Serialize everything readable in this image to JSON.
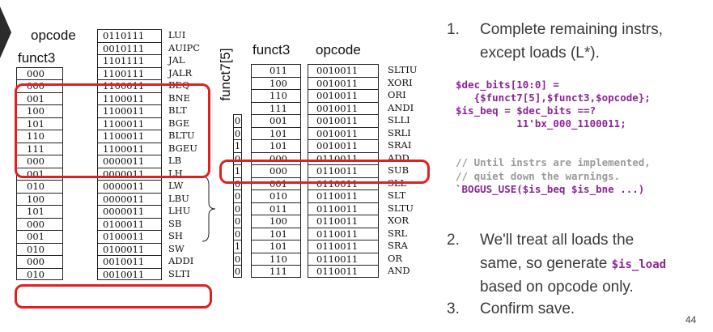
{
  "left_table": {
    "opcode_header": "opcode",
    "funct3_header": "funct3",
    "rows": [
      {
        "f3": "",
        "op": "0110111",
        "name": "LUI"
      },
      {
        "f3": "",
        "op": "0010111",
        "name": "AUIPC"
      },
      {
        "f3": "",
        "op": "1101111",
        "name": "JAL"
      },
      {
        "f3": "000",
        "op": "1100111",
        "name": "JALR"
      },
      {
        "f3": "000",
        "op": "1100011",
        "name": "BEQ"
      },
      {
        "f3": "001",
        "op": "1100011",
        "name": "BNE"
      },
      {
        "f3": "100",
        "op": "1100011",
        "name": "BLT"
      },
      {
        "f3": "101",
        "op": "1100011",
        "name": "BGE"
      },
      {
        "f3": "110",
        "op": "1100011",
        "name": "BLTU"
      },
      {
        "f3": "111",
        "op": "1100011",
        "name": "BGEU"
      },
      {
        "f3": "000",
        "op": "0000011",
        "name": "LB"
      },
      {
        "f3": "001",
        "op": "0000011",
        "name": "LH"
      },
      {
        "f3": "010",
        "op": "0000011",
        "name": "LW"
      },
      {
        "f3": "100",
        "op": "0000011",
        "name": "LBU"
      },
      {
        "f3": "101",
        "op": "0000011",
        "name": "LHU"
      },
      {
        "f3": "000",
        "op": "0100011",
        "name": "SB"
      },
      {
        "f3": "001",
        "op": "0100011",
        "name": "SH"
      },
      {
        "f3": "010",
        "op": "0100011",
        "name": "SW"
      },
      {
        "f3": "000",
        "op": "0010011",
        "name": "ADDI"
      },
      {
        "f3": "010",
        "op": "0010011",
        "name": "SLTI"
      }
    ]
  },
  "right_table": {
    "funct7_header": "funct7[5]",
    "funct3_header": "funct3",
    "opcode_header": "opcode",
    "rows": [
      {
        "f7": "",
        "f3": "011",
        "op": "0010011",
        "name": "SLTIU"
      },
      {
        "f7": "",
        "f3": "100",
        "op": "0010011",
        "name": "XORI"
      },
      {
        "f7": "",
        "f3": "110",
        "op": "0010011",
        "name": "ORI"
      },
      {
        "f7": "",
        "f3": "111",
        "op": "0010011",
        "name": "ANDI"
      },
      {
        "f7": "0",
        "f3": "001",
        "op": "0010011",
        "name": "SLLI"
      },
      {
        "f7": "0",
        "f3": "101",
        "op": "0010011",
        "name": "SRLI"
      },
      {
        "f7": "1",
        "f3": "101",
        "op": "0010011",
        "name": "SRAI"
      },
      {
        "f7": "0",
        "f3": "000",
        "op": "0110011",
        "name": "ADD"
      },
      {
        "f7": "1",
        "f3": "000",
        "op": "0110011",
        "name": "SUB"
      },
      {
        "f7": "0",
        "f3": "001",
        "op": "0110011",
        "name": "SLL"
      },
      {
        "f7": "0",
        "f3": "010",
        "op": "0110011",
        "name": "SLT"
      },
      {
        "f7": "0",
        "f3": "011",
        "op": "0110011",
        "name": "SLTU"
      },
      {
        "f7": "0",
        "f3": "100",
        "op": "0110011",
        "name": "XOR"
      },
      {
        "f7": "0",
        "f3": "101",
        "op": "0110011",
        "name": "SRL"
      },
      {
        "f7": "1",
        "f3": "101",
        "op": "0110011",
        "name": "SRA"
      },
      {
        "f7": "0",
        "f3": "110",
        "op": "0110011",
        "name": "OR"
      },
      {
        "f7": "0",
        "f3": "111",
        "op": "0110011",
        "name": "AND"
      }
    ]
  },
  "instructions": {
    "step1_num": "1.",
    "step1_line1": "Complete remaining instrs,",
    "step1_line2": "except loads (L*).",
    "code1_line1": "$dec_bits[10:0] =",
    "code1_line2": "   {$funct7[5],$funct3,$opcode};",
    "code1_line3": "$is_beq = $dec_bits ==?",
    "code1_line4": "          11'bx_000_1100011;",
    "code2_line1": "// Until instrs are implemented,",
    "code2_line2": "// quiet down the warnings.",
    "code2_line3": "`BOGUS_USE($is_beq $is_bne ...)",
    "step2_num": "2.",
    "step2_line1": "We'll treat all loads the",
    "step2_line2a": "same, so generate ",
    "step2_code": "$is_load",
    "step2_line3": "based on opcode only.",
    "step3_num": "3.",
    "step3_line1": "Confirm save.",
    "page_number": "44"
  },
  "colors": {
    "highlight_box": "#e02020",
    "code_purple": "#8b2596",
    "comment_gray": "#9a9a9a",
    "step_text": "#3a3a3a"
  }
}
